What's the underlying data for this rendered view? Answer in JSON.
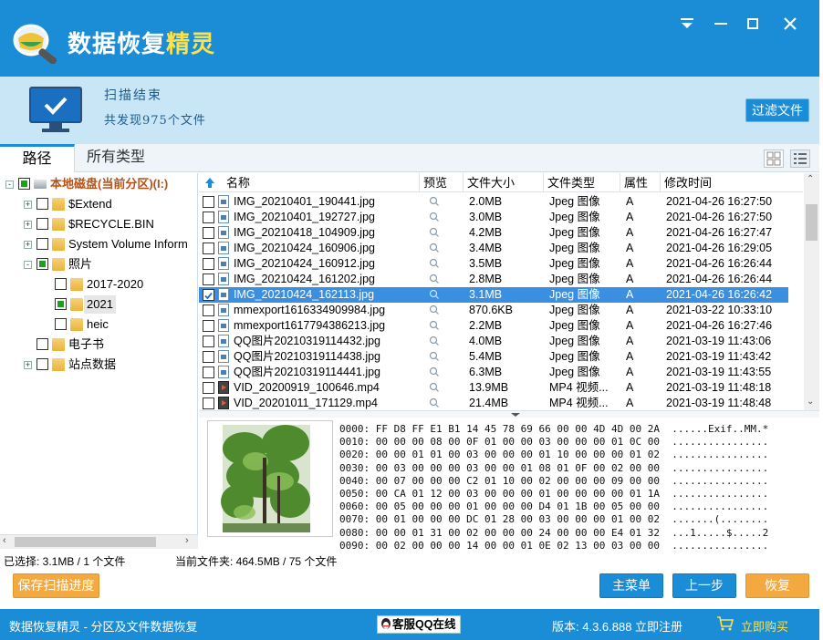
{
  "app": {
    "title_main": "数据恢复",
    "title_accent": "精灵",
    "window_controls": [
      "menu-icon",
      "minimize-icon",
      "maximize-icon",
      "close-icon"
    ]
  },
  "status": {
    "title": "扫描结束",
    "count": "共发现975个文件",
    "filter_button": "过滤文件"
  },
  "tabs": [
    "路径",
    "所有类型"
  ],
  "tree": [
    {
      "label": "本地磁盘(当前分区)(I:)",
      "level": 0,
      "expander": "-",
      "state": "partial",
      "icon": "drive"
    },
    {
      "label": "$Extend",
      "level": 1,
      "expander": "+",
      "state": "none",
      "icon": "folder"
    },
    {
      "label": "$RECYCLE.BIN",
      "level": 1,
      "expander": "+",
      "state": "none",
      "icon": "folder"
    },
    {
      "label": "System Volume Inform",
      "level": 1,
      "expander": "+",
      "state": "none",
      "icon": "folder"
    },
    {
      "label": "照片",
      "level": 1,
      "expander": "-",
      "state": "partial",
      "icon": "folder"
    },
    {
      "label": "2017-2020",
      "level": 2,
      "expander": "",
      "state": "none",
      "icon": "folder"
    },
    {
      "label": "2021",
      "level": 2,
      "expander": "",
      "state": "partial",
      "icon": "folder",
      "selected": true
    },
    {
      "label": "heic",
      "level": 2,
      "expander": "",
      "state": "none",
      "icon": "folder"
    },
    {
      "label": "电子书",
      "level": 1,
      "expander": "",
      "state": "none",
      "icon": "folder"
    },
    {
      "label": "站点数据",
      "level": 1,
      "expander": "+",
      "state": "none",
      "icon": "folder"
    }
  ],
  "columns": [
    "名称",
    "预览",
    "文件大小",
    "文件类型",
    "属性",
    "修改时间"
  ],
  "files": [
    {
      "name": "IMG_20210401_190441.jpg",
      "size": "2.0MB",
      "type": "Jpeg 图像",
      "attr": "A",
      "time": "2021-04-26 16:27:50",
      "icon": "img",
      "checked": false
    },
    {
      "name": "IMG_20210401_192727.jpg",
      "size": "3.0MB",
      "type": "Jpeg 图像",
      "attr": "A",
      "time": "2021-04-26 16:27:50",
      "icon": "img",
      "checked": false
    },
    {
      "name": "IMG_20210418_104909.jpg",
      "size": "4.2MB",
      "type": "Jpeg 图像",
      "attr": "A",
      "time": "2021-04-26 16:27:47",
      "icon": "img",
      "checked": false
    },
    {
      "name": "IMG_20210424_160906.jpg",
      "size": "3.4MB",
      "type": "Jpeg 图像",
      "attr": "A",
      "time": "2021-04-26 16:29:05",
      "icon": "img",
      "checked": false
    },
    {
      "name": "IMG_20210424_160912.jpg",
      "size": "3.5MB",
      "type": "Jpeg 图像",
      "attr": "A",
      "time": "2021-04-26 16:26:44",
      "icon": "img",
      "checked": false
    },
    {
      "name": "IMG_20210424_161202.jpg",
      "size": "2.8MB",
      "type": "Jpeg 图像",
      "attr": "A",
      "time": "2021-04-26 16:26:44",
      "icon": "img",
      "checked": false
    },
    {
      "name": "IMG_20210424_162113.jpg",
      "size": "3.1MB",
      "type": "Jpeg 图像",
      "attr": "A",
      "time": "2021-04-26 16:26:42",
      "icon": "img",
      "checked": true,
      "selected": true
    },
    {
      "name": "mmexport1616334909984.jpg",
      "size": "870.6KB",
      "type": "Jpeg 图像",
      "attr": "A",
      "time": "2021-03-22 10:33:10",
      "icon": "img",
      "checked": false
    },
    {
      "name": "mmexport1617794386213.jpg",
      "size": "2.2MB",
      "type": "Jpeg 图像",
      "attr": "A",
      "time": "2021-04-26 16:27:46",
      "icon": "img",
      "checked": false
    },
    {
      "name": "QQ图片20210319114432.jpg",
      "size": "4.0MB",
      "type": "Jpeg 图像",
      "attr": "A",
      "time": "2021-03-19 11:43:06",
      "icon": "img",
      "checked": false
    },
    {
      "name": "QQ图片20210319114438.jpg",
      "size": "5.4MB",
      "type": "Jpeg 图像",
      "attr": "A",
      "time": "2021-03-19 11:43:42",
      "icon": "img",
      "checked": false
    },
    {
      "name": "QQ图片20210319114441.jpg",
      "size": "6.3MB",
      "type": "Jpeg 图像",
      "attr": "A",
      "time": "2021-03-19 11:43:55",
      "icon": "img",
      "checked": false
    },
    {
      "name": "VID_20200919_100646.mp4",
      "size": "13.9MB",
      "type": "MP4 视频...",
      "attr": "A",
      "time": "2021-03-19 11:48:18",
      "icon": "vid",
      "checked": false
    },
    {
      "name": "VID_20201011_171129.mp4",
      "size": "21.4MB",
      "type": "MP4 视频...",
      "attr": "A",
      "time": "2021-03-19 11:48:48",
      "icon": "vid",
      "checked": false
    }
  ],
  "hex": [
    "0000: FF D8 FF E1 B1 14 45 78 69 66 00 00 4D 4D 00 2A  ......Exif..MM.*",
    "0010: 00 00 00 08 00 0F 01 00 00 03 00 00 00 01 0C 00  ................",
    "0020: 00 00 01 01 00 03 00 00 00 01 10 00 00 00 01 02  ................",
    "0030: 00 03 00 00 00 03 00 00 01 08 01 0F 00 02 00 00  ................",
    "0040: 00 07 00 00 00 C2 01 10 00 02 00 00 00 09 00 00  ................",
    "0050: 00 CA 01 12 00 03 00 00 00 01 00 00 00 00 01 1A  ................",
    "0060: 00 05 00 00 00 01 00 00 00 D4 01 1B 00 05 00 00  ................",
    "0070: 00 01 00 00 00 DC 01 28 00 03 00 00 00 01 00 02  .......(........",
    "0080: 00 00 01 31 00 02 00 00 00 24 00 00 00 E4 01 32  ...1.....$.....2",
    "0090: 00 02 00 00 00 14 00 00 01 0E 02 13 00 03 00 00  ................"
  ],
  "bottom": {
    "selected": "已选择: 3.1MB / 1 个文件",
    "current": "当前文件夹:  464.5MB / 75 个文件",
    "save_button": "保存扫描进度",
    "main_button": "主菜单",
    "prev_button": "上一步",
    "recover_button": "恢复"
  },
  "footer": {
    "text": "数据恢复精灵 - 分区及文件数据恢复",
    "qq": "客服QQ在线",
    "version": "版本:  4.3.6.888  立即注册",
    "buy": "立即购买"
  },
  "colors": {
    "primary": "#1a8dd6",
    "accent": "#f4a940",
    "highlight": "#ffe24a",
    "selection": "#3b8fe0",
    "band": "#c9e6f7"
  }
}
